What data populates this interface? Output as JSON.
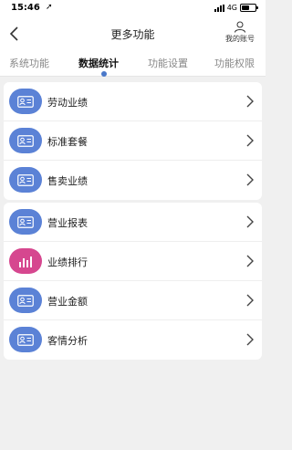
{
  "status_bar": {
    "time": "15:46",
    "network": "4G"
  },
  "nav": {
    "title": "更多功能",
    "account_label": "我的账号"
  },
  "tabs": [
    {
      "label": "系统功能",
      "active": false
    },
    {
      "label": "数据统计",
      "active": true
    },
    {
      "label": "功能设置",
      "active": false
    },
    {
      "label": "功能权限",
      "active": false
    }
  ],
  "groups": [
    {
      "items": [
        {
          "label": "劳动业绩",
          "icon": "id-card-icon",
          "icon_color": "#5b82d6"
        },
        {
          "label": "标准套餐",
          "icon": "id-card-icon",
          "icon_color": "#5b82d6"
        },
        {
          "label": "售卖业绩",
          "icon": "id-card-icon",
          "icon_color": "#5b82d6"
        }
      ]
    },
    {
      "items": [
        {
          "label": "营业报表",
          "icon": "id-card-icon",
          "icon_color": "#5b82d6"
        },
        {
          "label": "业绩排行",
          "icon": "bar-chart-icon",
          "icon_color": "#d6478f"
        },
        {
          "label": "营业金额",
          "icon": "id-card-icon",
          "icon_color": "#5b82d6"
        },
        {
          "label": "客情分析",
          "icon": "id-card-icon",
          "icon_color": "#5b82d6"
        }
      ]
    }
  ],
  "colors": {
    "accent": "#4a78c9",
    "background": "#f0f0f0"
  }
}
